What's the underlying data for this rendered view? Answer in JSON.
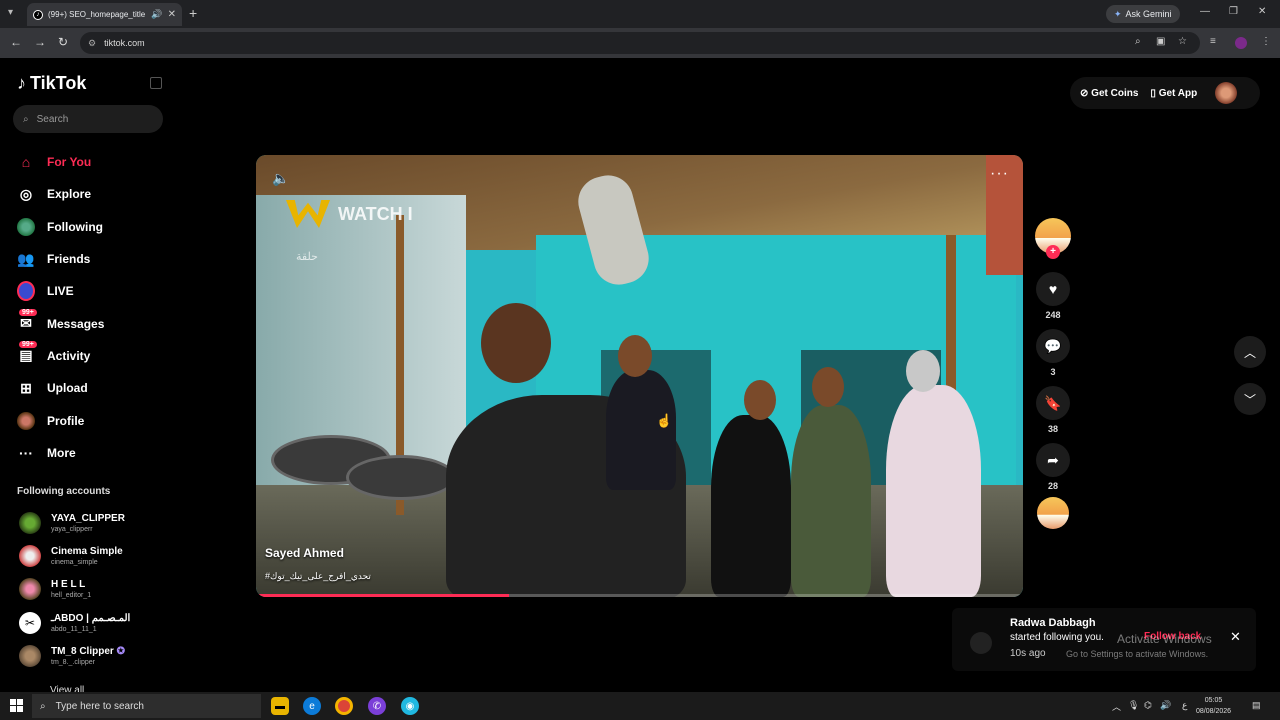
{
  "browser": {
    "tab_title": "(99+) SEO_homepage_title",
    "new_tab_symbol": "+",
    "ask_gemini": "Ask Gemini",
    "url": "tiktok.com"
  },
  "tiktok": {
    "logo_text": "TikTok",
    "search_placeholder": "Search",
    "nav": [
      {
        "label": "For You",
        "icon": "home-icon"
      },
      {
        "label": "Explore",
        "icon": "compass-icon"
      },
      {
        "label": "Following",
        "icon": "following-avatar"
      },
      {
        "label": "Friends",
        "icon": "friends-icon"
      },
      {
        "label": "LIVE",
        "icon": "live-avatar"
      },
      {
        "label": "Messages",
        "icon": "messages-icon",
        "badge": "99+"
      },
      {
        "label": "Activity",
        "icon": "activity-icon",
        "badge": "99+"
      },
      {
        "label": "Upload",
        "icon": "upload-icon"
      },
      {
        "label": "Profile",
        "icon": "profile-avatar"
      },
      {
        "label": "More",
        "icon": "more-icon"
      }
    ],
    "following_title": "Following accounts",
    "accounts": [
      {
        "name": "YAYA_CLIPPER",
        "handle": "yaya_clipperr"
      },
      {
        "name": "Cinema Simple",
        "handle": "cinema_simple"
      },
      {
        "name": "H E L L",
        "handle": "hell_editor_1"
      },
      {
        "name": "ـABDO | المـصـمم",
        "handle": "abdo_11_11_1"
      },
      {
        "name": "TM_8 Clipper",
        "handle": "tm_8._.clipper"
      }
    ],
    "view_all": "View all",
    "get_coins": "Get Coins",
    "get_app": "Get App"
  },
  "video": {
    "watermark": "WATCH I",
    "overlay_tag": "حلقة",
    "author": "Sayed Ahmed",
    "hashtag": "#تحدي_افرج_على_تيك_توك",
    "progress": 0.33
  },
  "actions": {
    "likes": "248",
    "comments": "3",
    "saves": "38",
    "shares": "28"
  },
  "toast": {
    "name": "Radwa Dabbagh",
    "text": "started following you.",
    "time": "10s ago",
    "follow_back": "Follow back",
    "windows_line1": "Activate Windows",
    "windows_line2": "Go to Settings to activate Windows."
  },
  "taskbar": {
    "search_placeholder": "Type here to search",
    "time": "05:05",
    "date": "08/08/2026"
  },
  "colors": {
    "accent": "#fe2c55",
    "page_bg": "#000000"
  }
}
